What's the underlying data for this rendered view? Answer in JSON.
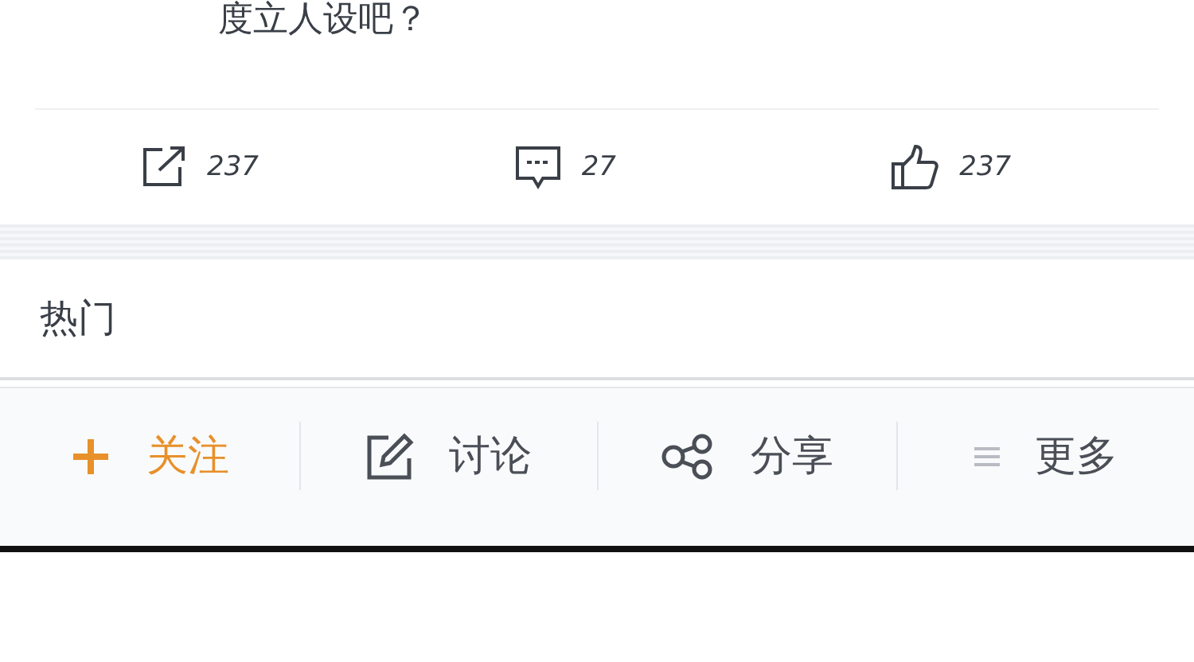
{
  "post": {
    "text": "度立人设吧？"
  },
  "stats": [
    {
      "kind": "repost",
      "count": "237"
    },
    {
      "kind": "comment",
      "count": "27"
    },
    {
      "kind": "like",
      "count": "237"
    }
  ],
  "section": {
    "title": "热门"
  },
  "toolbar": [
    {
      "kind": "follow",
      "label": "关注",
      "highlighted": true
    },
    {
      "kind": "discuss",
      "label": "讨论",
      "highlighted": false
    },
    {
      "kind": "share",
      "label": "分享",
      "highlighted": false
    },
    {
      "kind": "more",
      "label": "更多",
      "highlighted": false
    }
  ]
}
